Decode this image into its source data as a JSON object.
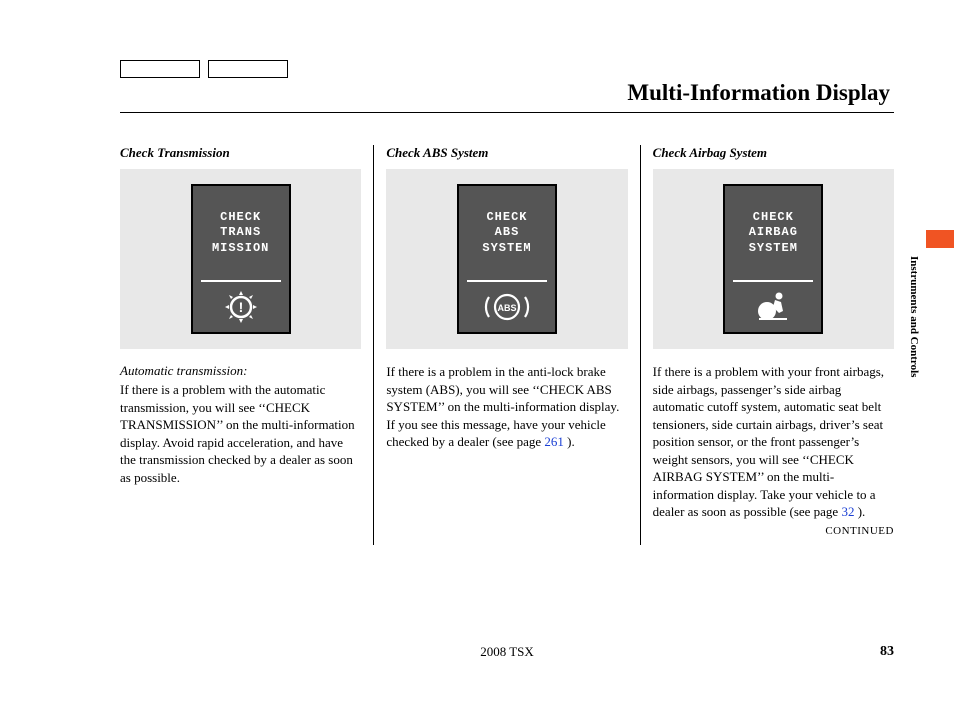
{
  "page": {
    "title": "Multi-Information Display",
    "model_year": "2008  TSX",
    "page_number": "83",
    "side_label": "Instruments and Controls",
    "continued": "CONTINUED"
  },
  "columns": [
    {
      "title": "Check Transmission",
      "screen_lines": [
        "CHECK",
        "TRANS",
        "MISSION"
      ],
      "icon": "gear-warning",
      "sub_note": "Automatic transmission:",
      "body": "If there is a problem with the automatic transmission, you will see ‘‘CHECK TRANSMISSION’’ on the multi-information display. Avoid rapid acceleration, and have the transmission checked by a dealer as soon as possible.",
      "page_ref": null
    },
    {
      "title": "Check ABS System",
      "screen_lines": [
        "CHECK",
        "ABS",
        "SYSTEM"
      ],
      "icon": "abs",
      "sub_note": null,
      "body_pre": "If there is a problem in the anti-lock brake system (ABS), you will see ‘‘CHECK ABS SYSTEM’’ on the multi-information display. If you see this message, have your vehicle checked by a dealer (see page ",
      "page_ref": "261",
      "body_post": " )."
    },
    {
      "title": "Check Airbag System",
      "screen_lines": [
        "CHECK",
        "AIRBAG",
        "SYSTEM"
      ],
      "icon": "airbag",
      "sub_note": null,
      "body_pre": "If there is a problem with your front airbags, side airbags, passenger’s side airbag automatic cutoff system, automatic seat belt tensioners, side curtain airbags, driver’s seat position sensor, or the front passenger’s weight sensors, you will see ‘‘CHECK AIRBAG SYSTEM’’ on the multi-information display. Take your vehicle to a dealer as soon as possible (see page  ",
      "page_ref": "32",
      "body_post": "  )."
    }
  ]
}
